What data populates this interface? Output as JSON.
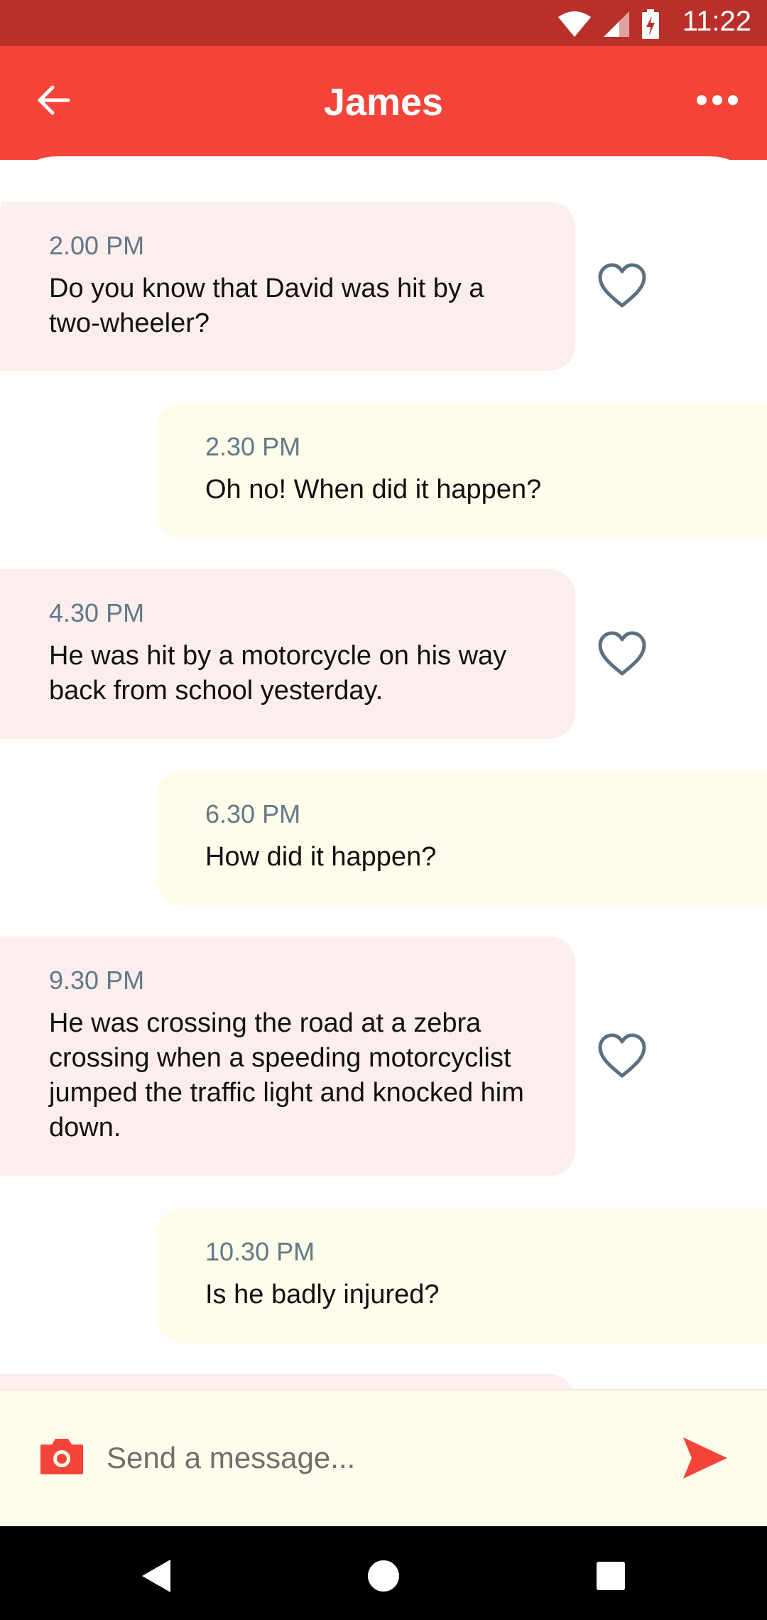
{
  "status_bar": {
    "time": "11:22"
  },
  "header": {
    "title": "James"
  },
  "messages": [
    {
      "time": "2.00 PM",
      "text": "Do you know that David was hit by a two-wheeler?"
    },
    {
      "time": "2.30 PM",
      "text": "Oh no! When did it happen?"
    },
    {
      "time": "4.30 PM",
      "text": "He was hit by a motorcycle on his way back from school yesterday."
    },
    {
      "time": "6.30 PM",
      "text": "How did it happen?"
    },
    {
      "time": "9.30 PM",
      "text": "He was crossing the road at a zebra crossing when a speeding motorcyclist jumped the traffic light and knocked him down."
    },
    {
      "time": "10.30 PM",
      "text": "Is he badly injured?"
    }
  ],
  "composer": {
    "placeholder": "Send a message..."
  },
  "icons": {
    "back": "arrow-left-icon",
    "more": "more-horizontal-icon",
    "like": "heart-outline-icon",
    "camera": "camera-icon",
    "send": "send-icon"
  },
  "colors": {
    "status_bar": "#b9302a",
    "app_bar": "#f4443a",
    "incoming_bubble": "#fdeeee",
    "outgoing_bubble": "#fefcea",
    "timestamp": "#627888",
    "heart": "#5b7080"
  }
}
